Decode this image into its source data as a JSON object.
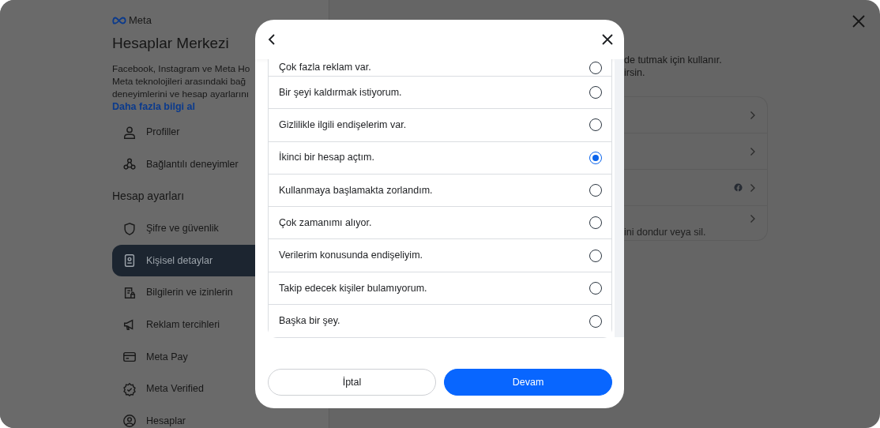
{
  "sidebar": {
    "logo": "Meta",
    "title": "Hesaplar Merkezi",
    "description_lines": [
      "Facebook, Instagram ve Meta Ho",
      "Meta teknolojileri arasındaki bağ",
      "deneyimlerini ve hesap ayarlarını"
    ],
    "link": "Daha fazla bilgi al",
    "items": [
      {
        "kind": "link",
        "label": "Profiller",
        "selected": false
      },
      {
        "kind": "link",
        "label": "Bağlantılı deneyimler",
        "selected": false
      },
      {
        "kind": "heading",
        "label": "Hesap ayarları"
      },
      {
        "kind": "link",
        "label": "Şifre ve güvenlik",
        "selected": false
      },
      {
        "kind": "link",
        "label": "Kişisel detaylar",
        "selected": true
      },
      {
        "kind": "link",
        "label": "Bilgilerin ve izinlerin",
        "selected": false
      },
      {
        "kind": "link",
        "label": "Reklam tercihleri",
        "selected": false
      },
      {
        "kind": "link",
        "label": "Meta Pay",
        "selected": false
      },
      {
        "kind": "link",
        "label": "Meta Verified",
        "selected": false
      },
      {
        "kind": "link",
        "label": "Hesaplar",
        "selected": false
      }
    ]
  },
  "main": {
    "description_lines": [
      "de tutmak için kullanır.",
      "irsin."
    ],
    "rows": [
      {
        "kind": "plain"
      },
      {
        "kind": "plain"
      },
      {
        "kind": "facebook"
      },
      {
        "kind": "note",
        "text": "ini dondur veya sil."
      }
    ]
  },
  "dialog": {
    "options": [
      {
        "label": "Çok fazla reklam var.",
        "selected": false
      },
      {
        "label": "Bir şeyi kaldırmak istiyorum.",
        "selected": false
      },
      {
        "label": "Gizlilikle ilgili endişelerim var.",
        "selected": false
      },
      {
        "label": "İkinci bir hesap açtım.",
        "selected": true
      },
      {
        "label": "Kullanmaya başlamakta zorlandım.",
        "selected": false
      },
      {
        "label": "Çok zamanımı alıyor.",
        "selected": false
      },
      {
        "label": "Verilerim konusunda endişeliyim.",
        "selected": false
      },
      {
        "label": "Takip edecek kişiler bulamıyorum.",
        "selected": false
      },
      {
        "label": "Başka bir şey.",
        "selected": false
      }
    ],
    "buttons": [
      {
        "kind": "secondary",
        "label": "İptal"
      },
      {
        "kind": "primary",
        "label": "Devam"
      }
    ]
  }
}
